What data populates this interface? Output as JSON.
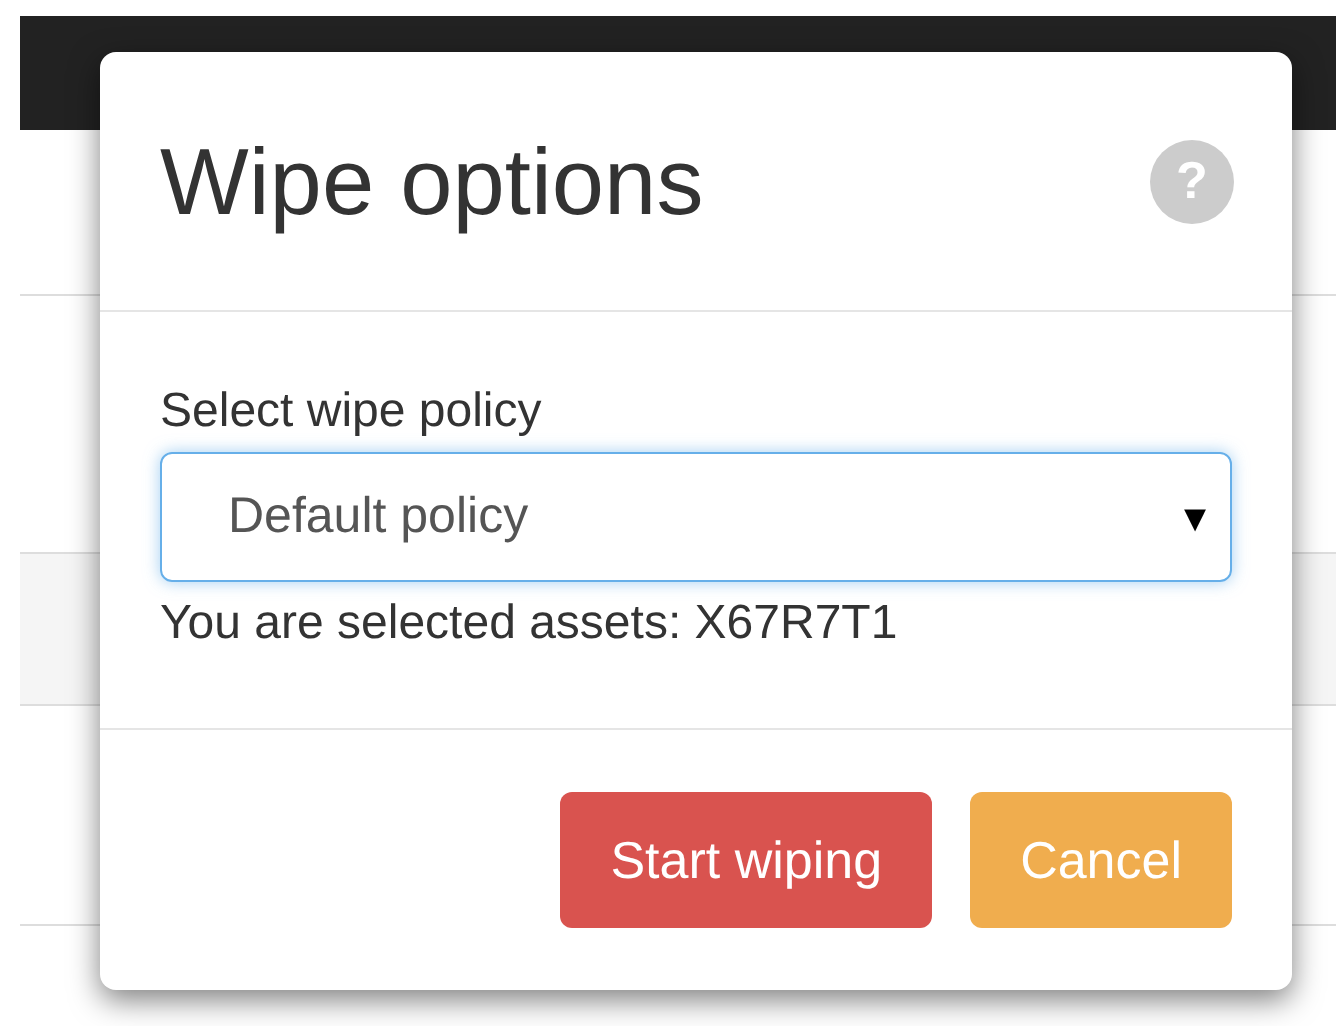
{
  "dialog": {
    "title": "Wipe options",
    "help": "?",
    "field": {
      "label": "Select wipe policy",
      "value": "Default policy",
      "caret": "▾"
    },
    "info": "You are selected assets: X67R7T1",
    "buttons": [
      {
        "label": "Start wiping",
        "kind": "danger"
      },
      {
        "label": "Cancel",
        "kind": "warning"
      }
    ]
  }
}
